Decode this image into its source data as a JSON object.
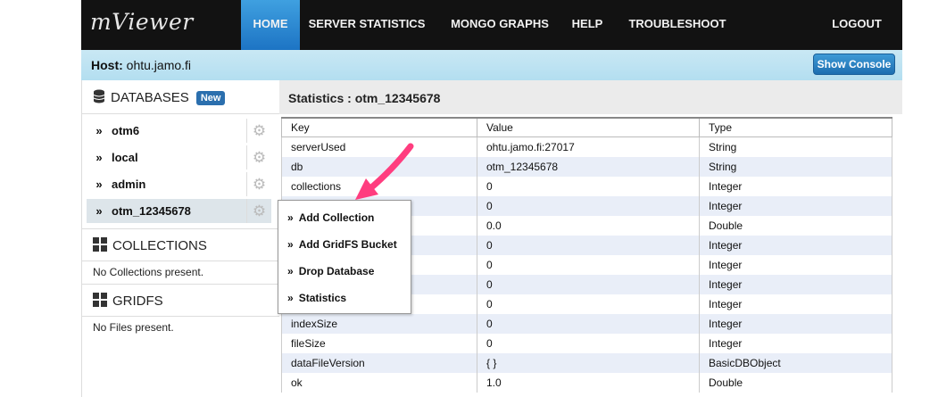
{
  "app": {
    "logo": "mViewer"
  },
  "nav": {
    "items": [
      {
        "label": "HOME",
        "active": true
      },
      {
        "label": "SERVER STATISTICS"
      },
      {
        "label": "MONGO GRAPHS"
      },
      {
        "label": "HELP"
      },
      {
        "label": "TROUBLESHOOT"
      },
      {
        "label": "LOGOUT"
      }
    ]
  },
  "host": {
    "label": "Host:",
    "value": "ohtu.jamo.fi",
    "console_button": "Show Console"
  },
  "sidebar": {
    "databases_title": "DATABASES",
    "new_badge": "New",
    "databases": [
      "otm6",
      "local",
      "admin",
      "otm_12345678"
    ],
    "selected_db": "otm_12345678",
    "collections_title": "COLLECTIONS",
    "collections_empty": "No Collections present.",
    "gridfs_title": "GRIDFS",
    "gridfs_empty": "No Files present."
  },
  "main": {
    "title": "Statistics : otm_12345678",
    "columns": [
      "Key",
      "Value",
      "Type"
    ],
    "rows": [
      [
        "serverUsed",
        "ohtu.jamo.fi:27017",
        "String"
      ],
      [
        "db",
        "otm_12345678",
        "String"
      ],
      [
        "collections",
        "0",
        "Integer"
      ],
      [
        "",
        "0",
        "Integer"
      ],
      [
        "",
        "0.0",
        "Double"
      ],
      [
        "",
        "0",
        "Integer"
      ],
      [
        "",
        "0",
        "Integer"
      ],
      [
        "",
        "0",
        "Integer"
      ],
      [
        "",
        "0",
        "Integer"
      ],
      [
        "indexSize",
        "0",
        "Integer"
      ],
      [
        "fileSize",
        "0",
        "Integer"
      ],
      [
        "dataFileVersion",
        "{ }",
        "BasicDBObject"
      ],
      [
        "ok",
        "1.0",
        "Double"
      ]
    ]
  },
  "context_menu": {
    "items": [
      "Add Collection",
      "Add GridFS Bucket",
      "Drop Database",
      "Statistics"
    ]
  },
  "icons": {
    "chevron": "»",
    "gear": "gear-icon",
    "database": "database-icon",
    "grid": "grid-icon"
  },
  "colors": {
    "accent_blue": "#1d74c4",
    "host_bar": "#b3def0",
    "arrow": "#ff3d7f"
  }
}
